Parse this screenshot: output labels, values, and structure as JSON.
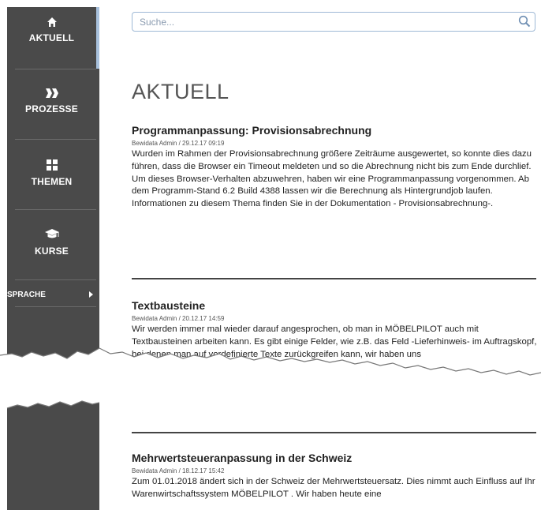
{
  "sidebar": {
    "items": [
      {
        "label": "AKTUELL",
        "icon": "home-icon"
      },
      {
        "label": "PROZESSE",
        "icon": "double-chevron-icon"
      },
      {
        "label": "THEMEN",
        "icon": "grid-icon"
      },
      {
        "label": "KURSE",
        "icon": "graduation-cap-icon"
      }
    ],
    "language": {
      "label": "SPRACHE",
      "icon": "caret-right-icon"
    }
  },
  "search": {
    "placeholder": "Suche...",
    "icon": "search-icon"
  },
  "page_title": "AKTUELL",
  "articles": [
    {
      "title": "Programmanpassung: Provisionsabrechnung",
      "meta": "Bewidata Admin / 29.12.17 09:19",
      "body": "Wurden im Rahmen der Provisionsabrechnung größere Zeiträume ausgewertet, so konnte dies dazu führen, dass die Browser ein Timeout meldeten und so die Abrechnung nicht bis zum Ende durchlief.\nUm dieses Browser-Verhalten abzuwehren, haben wir eine Programmanpassung vorgenommen. Ab dem Programm-Stand 6.2 Build 4388 lassen wir die Berechnung als Hintergrundjob laufen. Informationen zu diesem Thema finden Sie in der Dokumentation - Provisionsabrechnung-."
    },
    {
      "title": "Textbausteine",
      "meta": "Bewidata Admin / 20.12.17 14:59",
      "body": "Wir werden immer mal wieder darauf angesprochen, ob man in MÖBELPILOT auch mit Textbausteinen arbeiten kann. Es gibt einige Felder, wie z.B. das Feld -Lieferhinweis- im Auftragskopf, bei denen man auf vordefinierte Texte zurückgreifen kann, wir haben uns"
    },
    {
      "title": "Mehrwertsteueranpassung in der Schweiz",
      "meta": "Bewidata Admin / 18.12.17 15:42",
      "body": "Zum 01.01.2018 ändert sich in der Schweiz der Mehrwertsteuersatz. Dies nimmt auch Einfluss auf Ihr Warenwirtschaftssystem MÖBELPILOT . Wir haben heute eine"
    }
  ]
}
